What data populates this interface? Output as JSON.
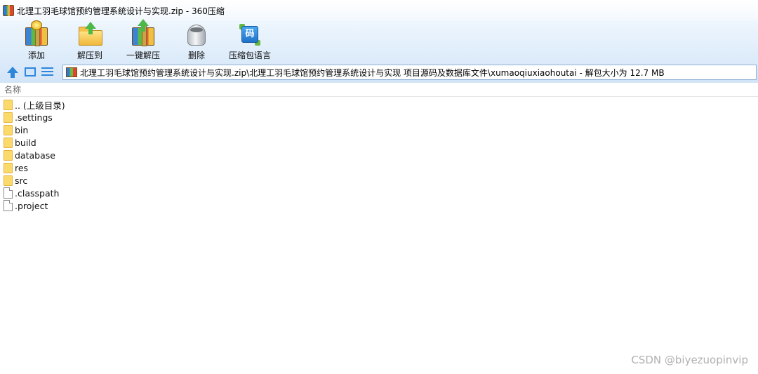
{
  "window": {
    "title": "北理工羽毛球馆预约管理系统设计与实现.zip - 360压缩"
  },
  "toolbar": {
    "items": [
      {
        "label": "添加",
        "icon": "add-archive-icon"
      },
      {
        "label": "解压到",
        "icon": "extract-to-icon"
      },
      {
        "label": "一键解压",
        "icon": "one-click-extract-icon"
      },
      {
        "label": "删除",
        "icon": "trash-icon"
      },
      {
        "label": "压缩包语言",
        "icon": "archive-language-icon",
        "icon_text": "码"
      }
    ]
  },
  "address_bar": {
    "path": "北理工羽毛球馆预约管理系统设计与实现.zip\\北理工羽毛球馆预约管理系统设计与实现 项目源码及数据库文件\\xumaoqiuxiaohoutai - 解包大小为 12.7 MB"
  },
  "columns": {
    "name": "名称"
  },
  "files": [
    {
      "name": ".. (上级目录)",
      "type": "folder"
    },
    {
      "name": ".settings",
      "type": "folder"
    },
    {
      "name": "bin",
      "type": "folder"
    },
    {
      "name": "build",
      "type": "folder"
    },
    {
      "name": "database",
      "type": "folder"
    },
    {
      "name": "res",
      "type": "folder"
    },
    {
      "name": "src",
      "type": "folder"
    },
    {
      "name": ".classpath",
      "type": "file"
    },
    {
      "name": ".project",
      "type": "file"
    }
  ],
  "watermark": "CSDN @biyezuopinvip",
  "colors": {
    "toolbar_bg": "#dcebfa",
    "folder": "#fbd96b",
    "accent": "#2f86db"
  }
}
